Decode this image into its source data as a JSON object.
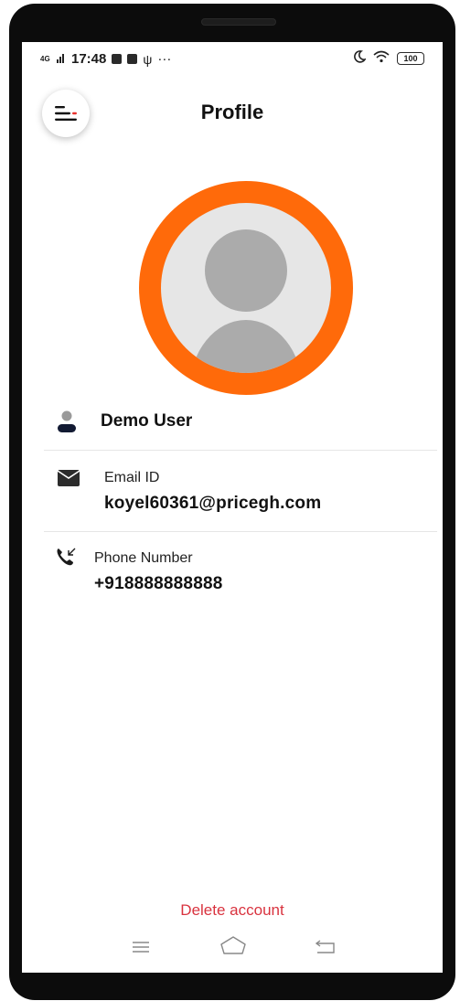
{
  "status_bar": {
    "network": "4G",
    "time": "17:48",
    "more_indicator": "···",
    "battery": "100"
  },
  "header": {
    "title": "Profile",
    "menu_icon": "menu-icon"
  },
  "profile": {
    "avatar_ring_color": "#FF6A0A",
    "name": "Demo User",
    "email_label": "Email ID",
    "email": "koyel60361@pricegh.com",
    "phone_label": "Phone Number",
    "phone": "+918888888888"
  },
  "footer": {
    "delete_label": "Delete account",
    "delete_color": "#D9333F"
  },
  "nav": {
    "items": [
      "recent-apps-icon",
      "home-icon",
      "back-icon"
    ]
  }
}
